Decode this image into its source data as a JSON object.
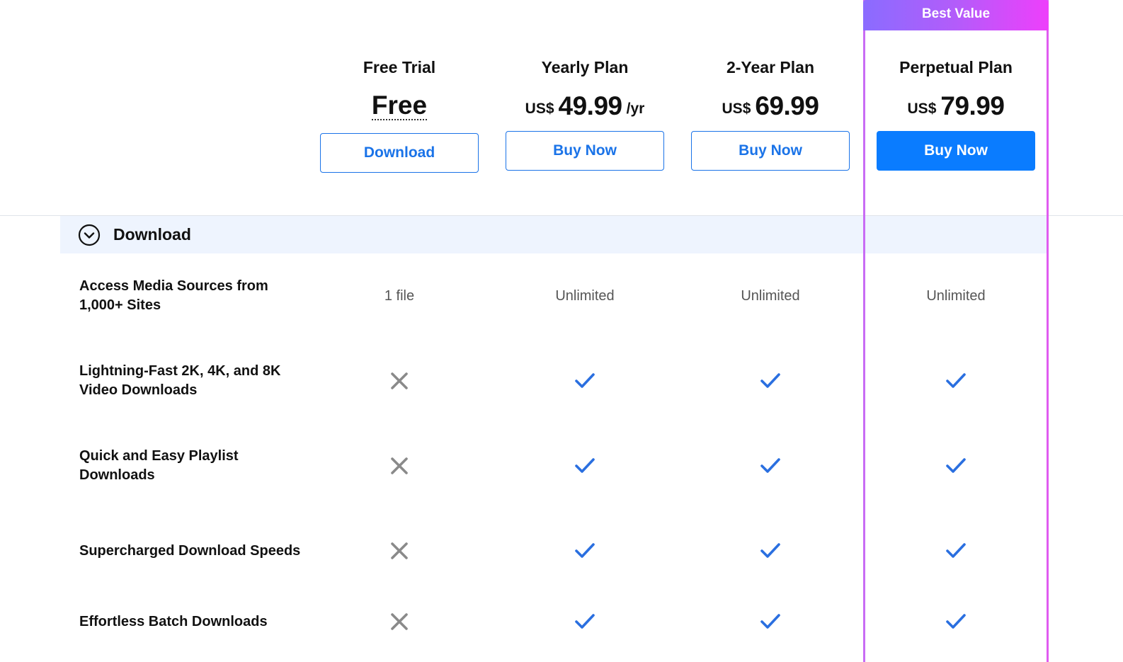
{
  "badge": "Best Value",
  "colors": {
    "accent_blue": "#0a7cff",
    "check": "#2a6fe0",
    "cross": "#8a8a8a",
    "highlight_gradient": [
      "#8a6cff",
      "#ee3ffb"
    ],
    "section_bg": "#eef4fe"
  },
  "plans": [
    {
      "name": "Free Trial",
      "price_free": "Free",
      "button": "Download"
    },
    {
      "name": "Yearly Plan",
      "currency": "US$",
      "amount": "49.99",
      "suffix": "/yr",
      "button": "Buy Now"
    },
    {
      "name": "2-Year Plan",
      "currency": "US$",
      "amount": "69.99",
      "button": "Buy Now"
    },
    {
      "name": "Perpetual Plan",
      "currency": "US$",
      "amount": "79.99",
      "button": "Buy Now"
    }
  ],
  "section": {
    "title": "Download",
    "icon": "chevron-down-circle-icon"
  },
  "features": [
    {
      "label": "Access Media Sources from 1,000+ Sites",
      "values": [
        "1 file",
        "Unlimited",
        "Unlimited",
        "Unlimited"
      ]
    },
    {
      "label": "Lightning-Fast 2K, 4K, and 8K Video Downloads",
      "values": [
        "cross",
        "check",
        "check",
        "check"
      ]
    },
    {
      "label": "Quick and Easy Playlist Downloads",
      "values": [
        "cross",
        "check",
        "check",
        "check"
      ]
    },
    {
      "label": "Supercharged Download Speeds",
      "values": [
        "cross",
        "check",
        "check",
        "check"
      ]
    },
    {
      "label": "Effortless Batch Downloads",
      "values": [
        "cross",
        "check",
        "check",
        "check"
      ]
    }
  ]
}
